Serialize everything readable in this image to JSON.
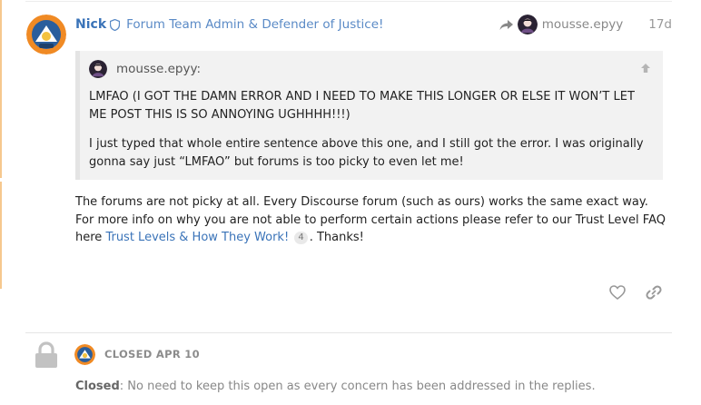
{
  "post": {
    "username": "Nick",
    "user_title": "Forum Team Admin & Defender of Justice!",
    "reply_to_user": "mousse.epyy",
    "date": "17d",
    "quote": {
      "author": "mousse.epyy:",
      "paragraph1": "LMFAO (I GOT THE DAMN ERROR AND I NEED TO MAKE THIS LONGER OR ELSE IT WON’T LET ME POST THIS IS SO ANNOYING UGHHHH!!!)",
      "paragraph2": "I just typed that whole entire sentence above this one, and I still got the error. I was originally gonna say just “LMFAO” but forums is too picky to even let me!"
    },
    "body_before_link": "The forums are not picky at all. Every Discourse forum (such as ours) works the same exact way. For more info on why you are not able to perform certain actions please refer to our Trust Level FAQ here ",
    "link_text": "Trust Levels & How They Work!",
    "link_clicks": "4",
    "body_after_link": ". Thanks!"
  },
  "small_action": {
    "label": "CLOSED APR 10",
    "note_strong": "Closed",
    "note_text": ": No need to keep this open as every concern has been addressed in the replies."
  },
  "colors": {
    "accent": "#3a73b8",
    "left_rule": "#f6c88e"
  }
}
